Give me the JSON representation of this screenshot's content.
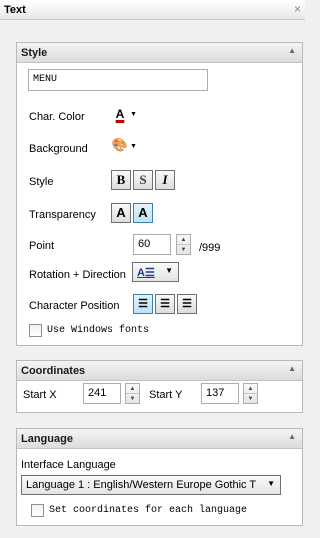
{
  "panel": {
    "title": "Text",
    "close_glyph": "×"
  },
  "groups": {
    "style": {
      "header": "Style",
      "caret": "▲",
      "text_value": "MENU",
      "char_color_label": "Char. Color",
      "background_label": "Background",
      "style_label": "Style",
      "style_buttons": [
        "B",
        "S",
        "I"
      ],
      "transparency_label": "Transparency",
      "transparency_buttons": [
        "A",
        "A"
      ],
      "point_label": "Point",
      "point_value": "60",
      "point_max": "/999",
      "rotation_label": "Rotation + Direction",
      "char_position_label": "Character Position",
      "use_windows_fonts_label": "Use Windows fonts",
      "use_windows_fonts_checked": false
    },
    "coordinates": {
      "header": "Coordinates",
      "caret": "▲",
      "start_x_label": "Start X",
      "start_x_value": "241",
      "start_y_label": "Start Y",
      "start_y_value": "137"
    },
    "language": {
      "header": "Language",
      "caret": "▲",
      "interface_language_label": "Interface Language",
      "selected_language": "Language 1 : English/Western Europe Gothic T",
      "set_coordinates_label": "Set coordinates for each language",
      "set_coordinates_checked": false
    }
  },
  "glyphs": {
    "dropdown": "▼",
    "spin_up": "▲",
    "spin_down": "▼"
  },
  "colors": {
    "text_color_underline": "#c00000",
    "active_button": "#bfe2fa"
  }
}
